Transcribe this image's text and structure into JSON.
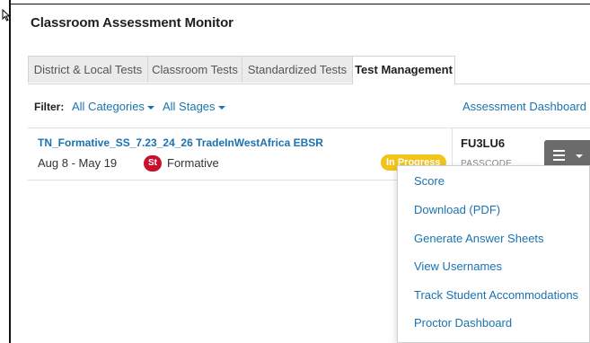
{
  "app": {
    "title": "Classroom Assessment Monitor"
  },
  "tabs": [
    {
      "label": "District & Local Tests"
    },
    {
      "label": "Classroom Tests"
    },
    {
      "label": "Standardized Tests"
    },
    {
      "label": "Test Management"
    }
  ],
  "filter": {
    "label": "Filter:",
    "categories": "All Categories",
    "stages": "All Stages"
  },
  "dashboard_link": "Assessment Dashboard",
  "test": {
    "name": "TN_Formative_SS_7.23_24_26 TradeInWestAfrica EBSR",
    "dates": "Aug 8 - May 19",
    "subject_badge": "St",
    "type": "Formative",
    "status": "In Progress",
    "passcode": "FU3LU6",
    "passcode_label": "PASSCODE"
  },
  "menu": {
    "items": [
      {
        "label": "Score"
      },
      {
        "label": "Download (PDF)"
      },
      {
        "label": "Generate Answer Sheets"
      },
      {
        "label": "View Usernames"
      },
      {
        "label": "Track Student Accommodations"
      },
      {
        "label": "Proctor Dashboard"
      }
    ]
  },
  "colors": {
    "link": "#1a73b0",
    "status_in_progress": "#f0c419",
    "subject_badge": "#c8102e",
    "menu_button": "#6b6b6b"
  }
}
